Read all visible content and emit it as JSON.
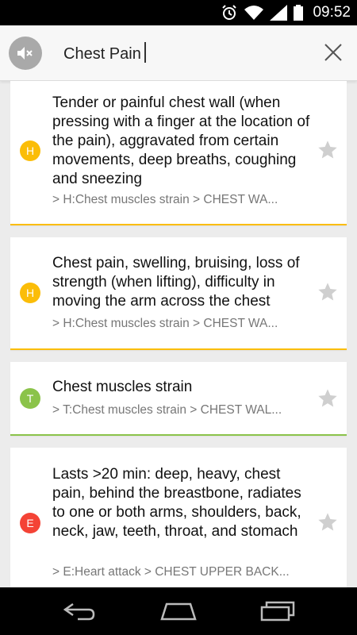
{
  "status_bar": {
    "time": "09:52",
    "icons": [
      "alarm-icon",
      "wifi-icon",
      "signal-icon",
      "battery-icon"
    ]
  },
  "search": {
    "value": "Chest Pain",
    "mute_icon": "mute-speaker-icon",
    "close_icon": "close-icon"
  },
  "colors": {
    "H": "#fbbd08",
    "T": "#8bc34a",
    "E": "#f44336",
    "star": "#cfcfcf"
  },
  "results": [
    {
      "badge": "H",
      "title": "Tender or painful chest wall (when pressing with a finger at the location of the pain), aggravated from certain movements, deep breaths, coughing and sneezing",
      "path": "> H:Chest muscles strain > CHEST WA..."
    },
    {
      "badge": "H",
      "title": "Chest pain, swelling, bruising, loss of strength (when lifting), difficulty in moving the arm across the chest",
      "path": "> H:Chest muscles strain > CHEST WA..."
    },
    {
      "badge": "T",
      "title": "Chest muscles strain",
      "path": "> T:Chest muscles strain > CHEST WAL..."
    },
    {
      "badge": "E",
      "title": "Lasts >20 min: deep, heavy, chest pain, behind the breastbone, radiates to one or both arms, shoulders, back, neck, jaw, teeth, throat, and stomach",
      "path": "> E:Heart attack > CHEST UPPER BACK..."
    }
  ],
  "nav": {
    "back_icon": "back-icon",
    "home_icon": "home-icon",
    "recents_icon": "recent-apps-icon"
  }
}
